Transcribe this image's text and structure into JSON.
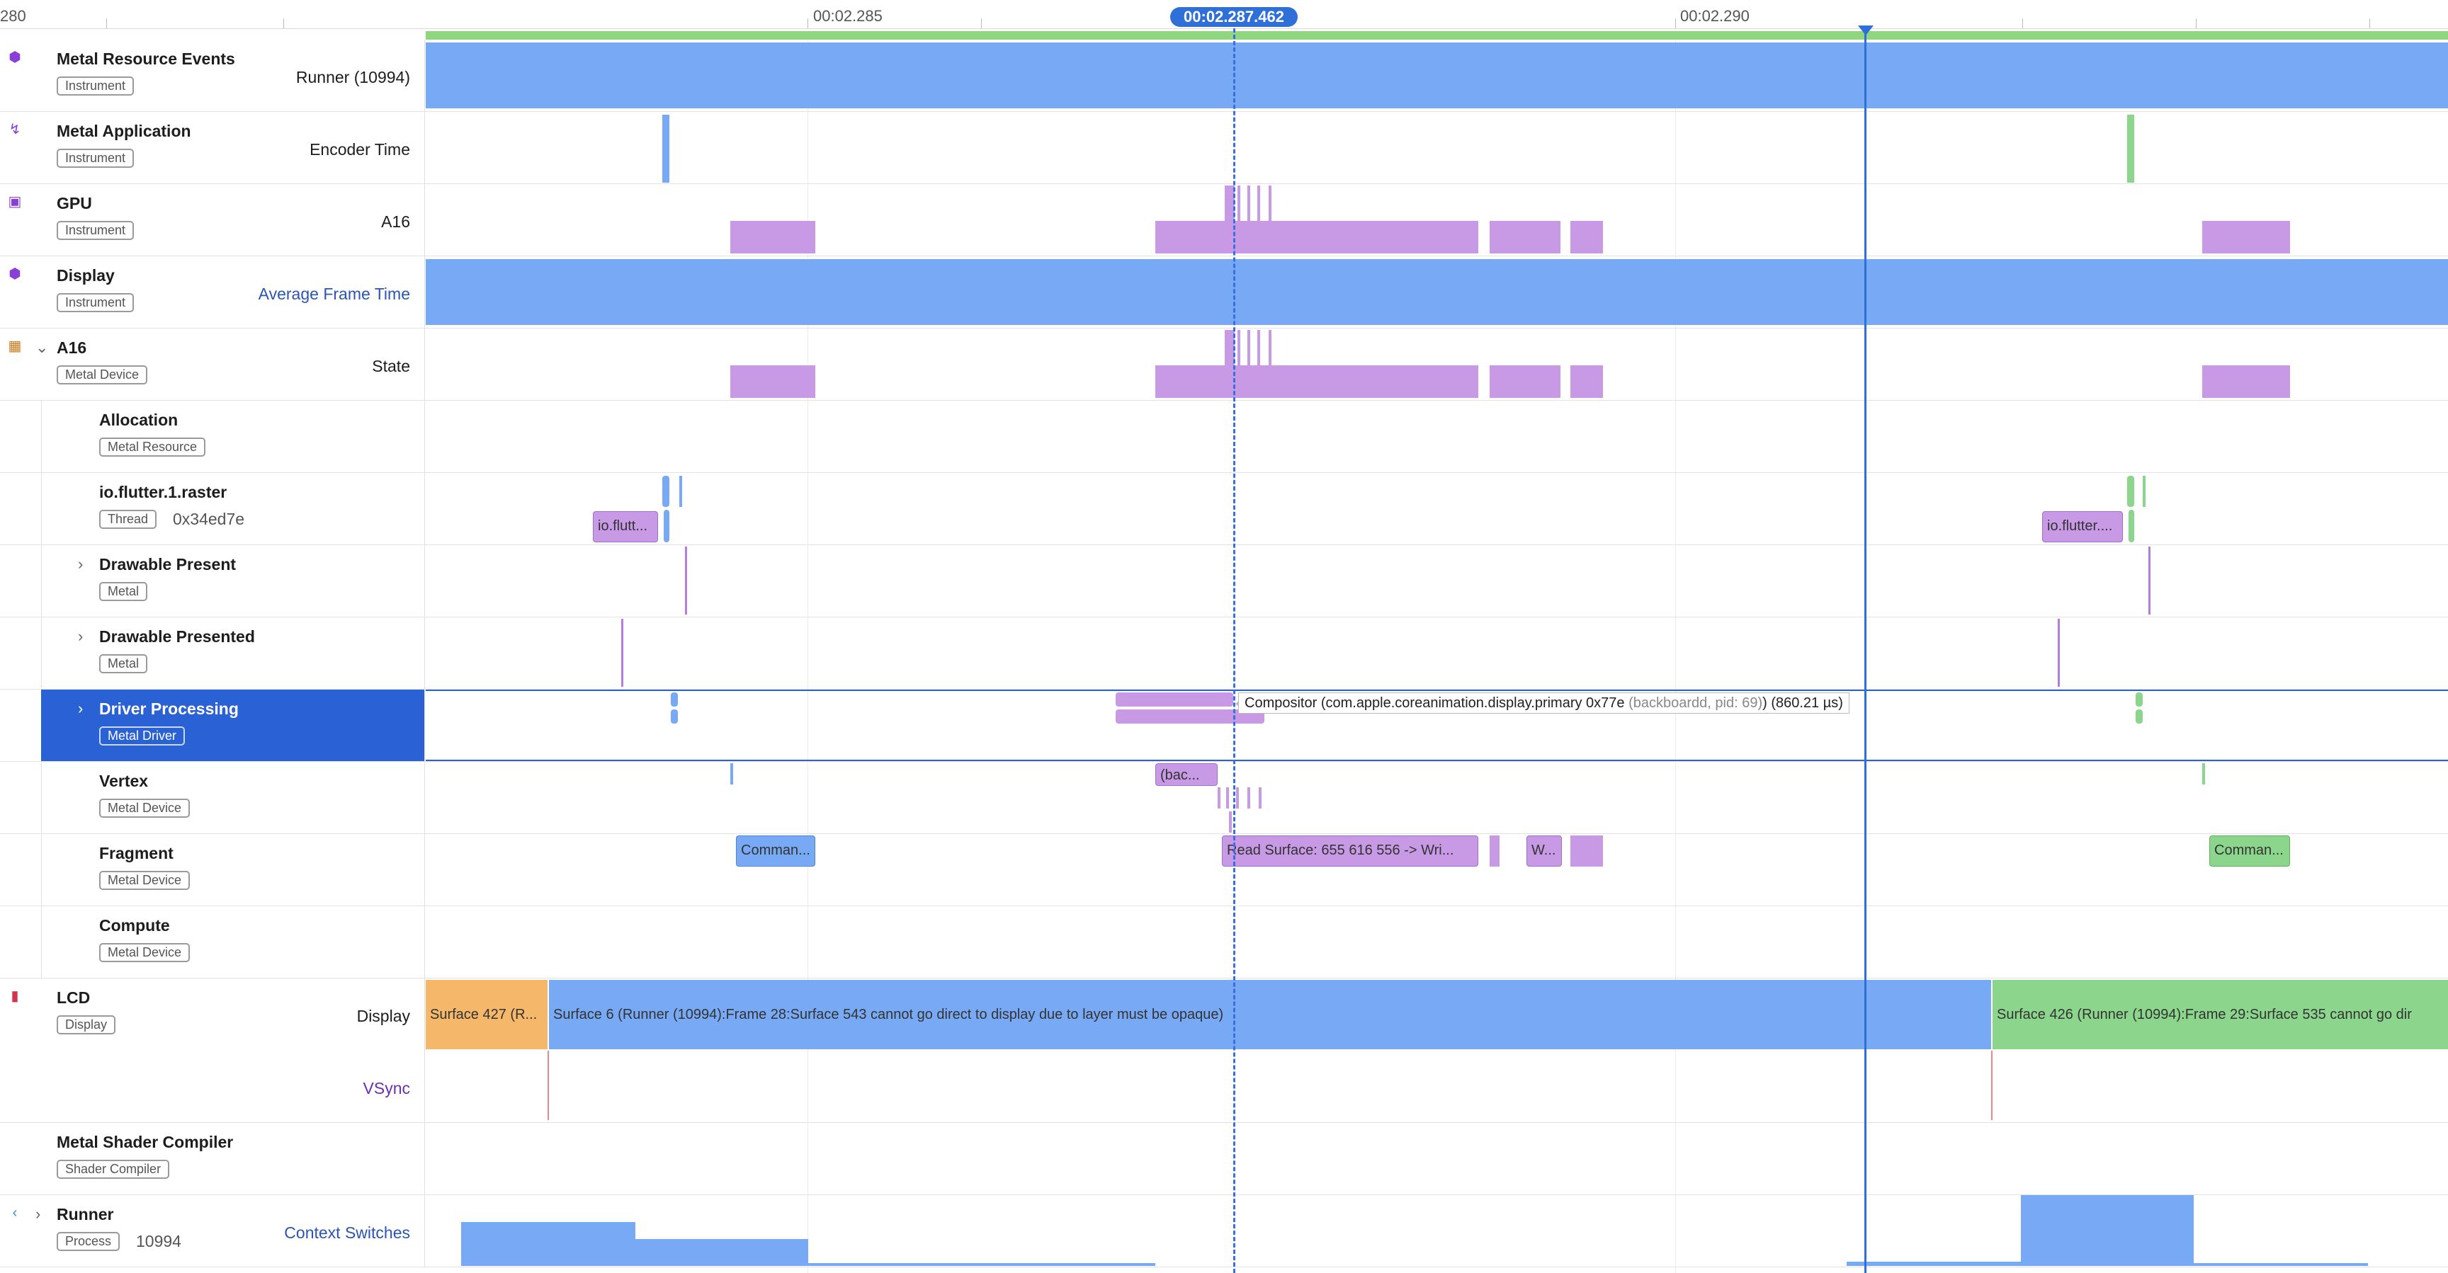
{
  "ruler": {
    "left_label": "280",
    "tick1": "00:02.285",
    "tick2": "00:02.290",
    "cursor_time": "00:02.287.462"
  },
  "rows": [
    {
      "title": "Metal Resource Events",
      "badge": "Instrument",
      "detail": "Runner (10994)",
      "icon": "cube-icon"
    },
    {
      "title": "Metal Application",
      "badge": "Instrument",
      "detail": "Encoder Time",
      "icon": "metal-icon"
    },
    {
      "title": "GPU",
      "badge": "Instrument",
      "detail": "A16",
      "icon": "gpu-chip-icon"
    },
    {
      "title": "Display",
      "badge": "Instrument",
      "detail": "Average Frame Time",
      "icon": "display-cube-icon"
    },
    {
      "title": "A16",
      "badge": "Metal Device",
      "detail": "State",
      "icon": "chip-icon"
    },
    {
      "title": "Allocation",
      "badge": "Metal Resource"
    },
    {
      "title": "io.flutter.1.raster",
      "badge": "Thread",
      "sub": "0x34ed7e"
    },
    {
      "title": "Drawable Present",
      "badge": "Metal"
    },
    {
      "title": "Drawable Presented",
      "badge": "Metal"
    },
    {
      "title": "Driver Processing",
      "badge": "Metal Driver"
    },
    {
      "title": "Vertex",
      "badge": "Metal Device"
    },
    {
      "title": "Fragment",
      "badge": "Metal Device"
    },
    {
      "title": "Compute",
      "badge": "Metal Device"
    },
    {
      "title": "LCD",
      "badge": "Display",
      "detail": "Display",
      "detail2": "VSync",
      "icon": "lcd-icon"
    },
    {
      "title": "Metal Shader Compiler",
      "badge": "Shader Compiler"
    },
    {
      "title": "Runner",
      "badge": "Process",
      "sub": "10994",
      "detail": "Context Switches",
      "icon": "flutter-icon"
    }
  ],
  "track_labels": {
    "raster_left": "io.flutt...",
    "raster_right": "io.flutter....",
    "vertex_bac": "(bac...",
    "fragment_left": "Comman...",
    "fragment_mid": "Read Surface: 655 616 556 -> Wri...",
    "fragment_w": "W...",
    "fragment_right": "Comman...",
    "lcd_1": "Surface 427 (R...",
    "lcd_2": "Surface 6 (Runner (10994):Frame 28:Surface 543 cannot go direct to display due to layer must be opaque)",
    "lcd_3": "Surface 426 (Runner (10994):Frame 29:Surface 535 cannot go dir"
  },
  "tooltip": {
    "main": "Compositor (com.apple.coreanimation.display.primary  0x77e ",
    "muted": "(backboardd, pid: 69)",
    "duration": ") (860.21 µs)"
  },
  "colors": {
    "blue": "#78a9f4",
    "purple": "#c89ae6",
    "green": "#8bd68c",
    "orange": "#f5b86a",
    "selection": "#2a62d6"
  }
}
